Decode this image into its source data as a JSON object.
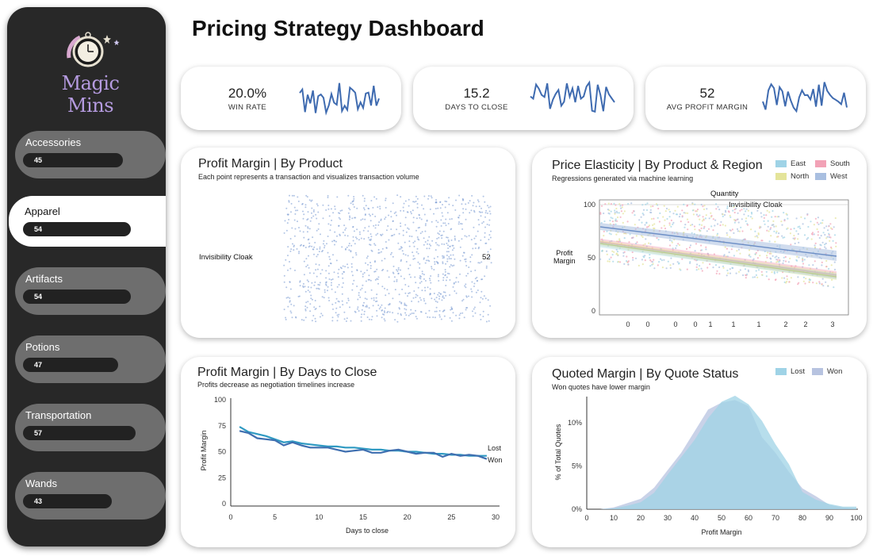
{
  "page": {
    "title": "Pricing Strategy Dashboard"
  },
  "brand": {
    "name": "Magic Mins"
  },
  "sidebar": {
    "items": [
      {
        "label": "Accessories",
        "value": "45",
        "pct": 45,
        "active": false
      },
      {
        "label": "Apparel",
        "value": "54",
        "pct": 54,
        "active": true
      },
      {
        "label": "Artifacts",
        "value": "54",
        "pct": 54,
        "active": false
      },
      {
        "label": "Potions",
        "value": "47",
        "pct": 47,
        "active": false
      },
      {
        "label": "Transportation",
        "value": "57",
        "pct": 57,
        "active": false
      },
      {
        "label": "Wands",
        "value": "43",
        "pct": 43,
        "active": false
      }
    ]
  },
  "kpis": [
    {
      "value": "20.0%",
      "label": "WIN RATE"
    },
    {
      "value": "15.2",
      "label": "DAYS TO CLOSE"
    },
    {
      "value": "52",
      "label": "AVG PROFIT MARGIN"
    }
  ],
  "panels": {
    "by_product": {
      "title": "Profit Margin | By Product",
      "subtitle": "Each point represents a transaction and visualizes transaction volume",
      "row_label": "Invisibility Cloak",
      "row_value": "52"
    },
    "elasticity": {
      "title": "Price Elasticity | By Product & Region",
      "subtitle": "Regressions generated via machine learning",
      "top_label": "Quantity",
      "facet_label": "Invisibility Cloak",
      "ylabel": "Profit\nMargin",
      "y_ticks": [
        "100",
        "50",
        "0"
      ],
      "x_ticks": [
        "0",
        "0",
        "0",
        "0",
        "1",
        "1",
        "1",
        "2",
        "2",
        "3"
      ],
      "legend": [
        {
          "name": "East",
          "color": "#9fd3e6"
        },
        {
          "name": "South",
          "color": "#f2a2b6"
        },
        {
          "name": "North",
          "color": "#e4e49a"
        },
        {
          "name": "West",
          "color": "#a9bfe0"
        }
      ]
    },
    "days_to_close": {
      "title": "Profit Margin | By Days to Close",
      "subtitle": "Profits decrease as negotiation timelines increase",
      "xlabel": "Days to close",
      "ylabel": "Profit Margin",
      "line_labels": [
        "Lost",
        "Won"
      ]
    },
    "quote_status": {
      "title": "Quoted Margin | By Quote Status",
      "subtitle": "Won quotes have lower margin",
      "xlabel": "Profit Margin",
      "ylabel": "% of Total Quotes",
      "legend": [
        {
          "name": "Lost",
          "color": "#9fd3e6"
        },
        {
          "name": "Won",
          "color": "#b7c3e0"
        }
      ]
    }
  },
  "chart_data": [
    {
      "type": "line",
      "title": "Profit Margin | By Days to Close",
      "xlabel": "Days to close",
      "ylabel": "Profit Margin",
      "xlim": [
        0,
        30
      ],
      "ylim": [
        0,
        100
      ],
      "x_ticks": [
        0,
        5,
        10,
        15,
        20,
        25,
        30
      ],
      "y_ticks": [
        0,
        25,
        50,
        75,
        100
      ],
      "x": [
        1,
        2,
        3,
        4,
        5,
        6,
        7,
        8,
        9,
        10,
        11,
        12,
        13,
        14,
        15,
        16,
        17,
        18,
        19,
        20,
        21,
        22,
        23,
        24,
        25,
        26,
        27,
        28,
        29
      ],
      "series": [
        {
          "name": "Lost",
          "color": "#2f9ac2",
          "values": [
            74,
            69,
            67,
            65,
            62,
            59,
            60,
            58,
            57,
            56,
            55,
            55,
            54,
            54,
            53,
            52,
            52,
            51,
            51,
            50,
            50,
            49,
            48,
            48,
            47,
            47,
            46,
            46,
            46
          ]
        },
        {
          "name": "Won",
          "color": "#3f6fb0",
          "values": [
            70,
            68,
            63,
            62,
            61,
            56,
            59,
            56,
            54,
            54,
            54,
            52,
            50,
            51,
            52,
            49,
            49,
            51,
            52,
            50,
            48,
            49,
            49,
            45,
            48,
            46,
            47,
            46,
            43
          ]
        }
      ]
    },
    {
      "type": "area",
      "title": "Quoted Margin | By Quote Status",
      "xlabel": "Profit Margin",
      "ylabel": "% of Total Quotes",
      "xlim": [
        0,
        100
      ],
      "ylim": [
        0,
        13
      ],
      "x_ticks": [
        0,
        10,
        20,
        30,
        40,
        50,
        60,
        70,
        80,
        90,
        100
      ],
      "y_ticks": [
        {
          "v": 0,
          "label": "0%"
        },
        {
          "v": 5,
          "label": "5%"
        },
        {
          "v": 10,
          "label": "10%"
        }
      ],
      "x": [
        0,
        5,
        10,
        15,
        20,
        25,
        30,
        35,
        40,
        45,
        50,
        55,
        60,
        65,
        70,
        75,
        80,
        85,
        90,
        95,
        100
      ],
      "series": [
        {
          "name": "Won",
          "color": "#b7c3e0",
          "values": [
            0,
            0,
            0.2,
            0.7,
            1.2,
            2.5,
            4.5,
            6.5,
            9,
            11.5,
            12.3,
            12.6,
            11.9,
            8.3,
            6.5,
            4.3,
            2.4,
            1.5,
            0.5,
            0.2,
            0.1
          ]
        },
        {
          "name": "Lost",
          "color": "#9fd3e6",
          "values": [
            0,
            0,
            0.1,
            0.4,
            0.8,
            1.9,
            4,
            6,
            8,
            10.5,
            12.4,
            13.1,
            12.1,
            10.2,
            7.5,
            5.2,
            2,
            1.1,
            0.6,
            0.3,
            0.3
          ]
        }
      ]
    }
  ]
}
